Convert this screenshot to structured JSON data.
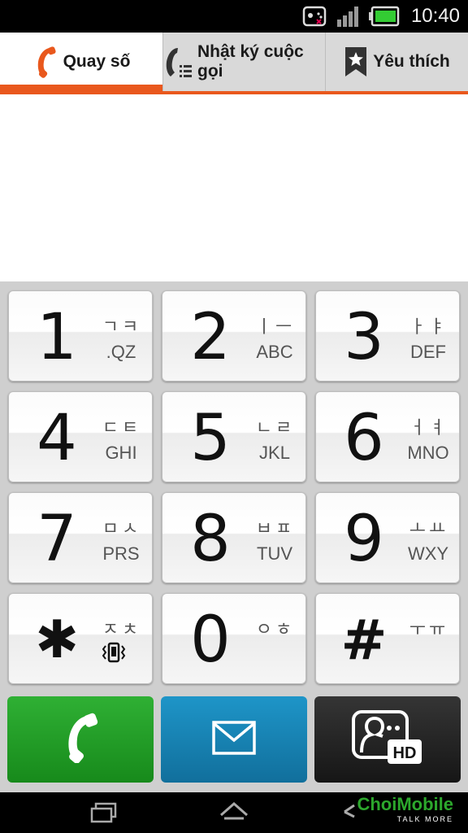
{
  "status_bar": {
    "time": "10:40"
  },
  "tabs": [
    {
      "label": "Quay số",
      "icon": "phone-handset-icon",
      "active": true
    },
    {
      "label": "Nhật ký cuộc gọi",
      "icon": "call-log-icon",
      "active": false
    },
    {
      "label": "Yêu thích",
      "icon": "bookmark-star-icon",
      "active": false
    }
  ],
  "keys": [
    {
      "digit": "1",
      "kor": "ㄱㅋ",
      "lat": ".QZ"
    },
    {
      "digit": "2",
      "kor": "ㅣㅡ",
      "lat": "ABC"
    },
    {
      "digit": "3",
      "kor": "ㅏㅑ",
      "lat": "DEF"
    },
    {
      "digit": "4",
      "kor": "ㄷㅌ",
      "lat": "GHI"
    },
    {
      "digit": "5",
      "kor": "ㄴㄹ",
      "lat": "JKL"
    },
    {
      "digit": "6",
      "kor": "ㅓㅕ",
      "lat": "MNO"
    },
    {
      "digit": "7",
      "kor": "ㅁㅅ",
      "lat": "PRS"
    },
    {
      "digit": "8",
      "kor": "ㅂㅍ",
      "lat": "TUV"
    },
    {
      "digit": "9",
      "kor": "ㅗㅛ",
      "lat": "WXY"
    },
    {
      "digit": "✱",
      "kor": "ㅈㅊ",
      "lat": ""
    },
    {
      "digit": "0",
      "kor": "ㅇㅎ",
      "lat": ""
    },
    {
      "digit": "#",
      "kor": "ㅜㅠ",
      "lat": ""
    }
  ],
  "action_buttons": {
    "call_icon": "phone-handset-icon",
    "message_icon": "envelope-icon",
    "video_call_icon": "hd-video-call-icon"
  },
  "watermark": {
    "brand": "ChoiMobile",
    "tagline": "TALK MORE"
  },
  "colors": {
    "accent": "#e9581d",
    "call_button": "#1f9a23",
    "message_button": "#1784b3",
    "video_button": "#262626"
  }
}
